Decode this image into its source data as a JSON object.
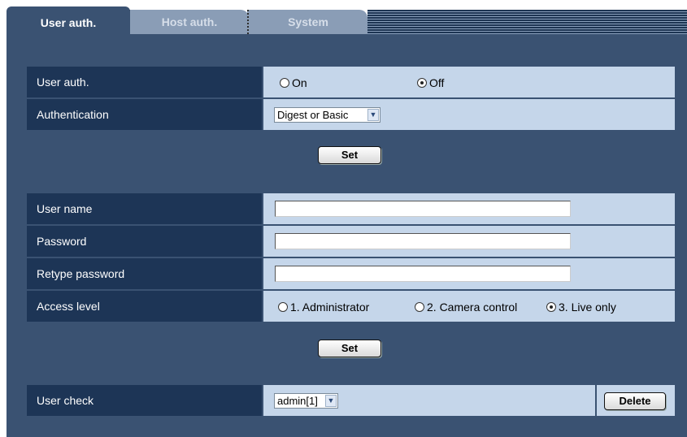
{
  "tabs": [
    {
      "label": "User auth.",
      "active": true
    },
    {
      "label": "Host auth.",
      "active": false
    },
    {
      "label": "System",
      "active": false
    }
  ],
  "user_auth": {
    "label": "User auth.",
    "options": [
      {
        "label": "On",
        "selected": false
      },
      {
        "label": "Off",
        "selected": true
      }
    ]
  },
  "authentication": {
    "label": "Authentication",
    "selected": "Digest or Basic"
  },
  "set_button_1": "Set",
  "user_name": {
    "label": "User name",
    "value": ""
  },
  "password": {
    "label": "Password",
    "value": ""
  },
  "retype_password": {
    "label": "Retype password",
    "value": ""
  },
  "access_level": {
    "label": "Access level",
    "options": [
      {
        "label": "1. Administrator",
        "selected": false
      },
      {
        "label": "2. Camera control",
        "selected": false
      },
      {
        "label": "3. Live only",
        "selected": true
      }
    ]
  },
  "set_button_2": "Set",
  "user_check": {
    "label": "User check",
    "selected": "admin[1]",
    "delete_label": "Delete"
  },
  "colors": {
    "panel_bg": "#3a5272",
    "label_bg": "#1d3556",
    "value_bg": "#c5d6ea",
    "inactive_tab_bg": "#8a9db6"
  }
}
